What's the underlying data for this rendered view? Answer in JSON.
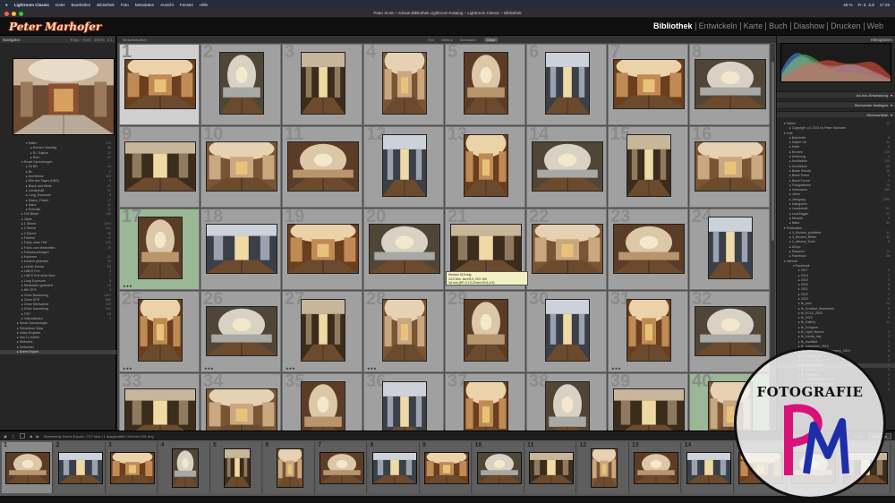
{
  "menubar": {
    "app": "Lightroom Classic",
    "items": [
      "Datei",
      "Bearbeiten",
      "Bibliothek",
      "Foto",
      "Metadaten",
      "Ansicht",
      "Fenster",
      "Hilfe"
    ],
    "status_items": [
      "48 %",
      "Fr. 5. Juli",
      "17:25"
    ]
  },
  "window": {
    "title": "Peter Scott – Artisan-Bibliothek Lightroom-Katalog – Lightroom Classic – Bibliothek"
  },
  "identity": {
    "logo_text": "Peter Marhofer",
    "modules": [
      {
        "label": "Bibliothek",
        "active": true
      },
      {
        "label": "Entwickeln",
        "active": false
      },
      {
        "label": "Karte",
        "active": false
      },
      {
        "label": "Buch",
        "active": false
      },
      {
        "label": "Diashow",
        "active": false
      },
      {
        "label": "Drucken",
        "active": false
      },
      {
        "label": "Web",
        "active": false
      }
    ]
  },
  "left_panel": {
    "navigator_label": "Navigator",
    "zoom_tabs": [
      "Einp.",
      "Ausf.",
      "100%",
      "1:1"
    ],
    "tree": [
      {
        "label": "▾ Italien",
        "count": "214",
        "indent": 3
      },
      {
        "label": "▸ Kirchen Venedig",
        "count": "38",
        "indent": 4
      },
      {
        "label": "▸ St. Sulpice",
        "count": "12",
        "indent": 4
      },
      {
        "label": "▸ Rom",
        "count": "87",
        "indent": 4
      },
      {
        "label": "▾ Smart Sammlungen",
        "count": "",
        "indent": 2
      },
      {
        "label": "▸ 28 NR",
        "count": "14",
        "indent": 3
      },
      {
        "label": "▸ NL",
        "count": "9",
        "indent": 3
      },
      {
        "label": "▸ Architektur",
        "count": "120",
        "indent": 3
      },
      {
        "label": "▸ Bild des Tages (DBS)",
        "count": "6",
        "indent": 3
      },
      {
        "label": "▸ Black and White",
        "count": "22",
        "indent": 3
      },
      {
        "label": "▸ Landschaft",
        "count": "51",
        "indent": 3
      },
      {
        "label": "▸ Long_Exposure",
        "count": "8",
        "indent": 3
      },
      {
        "label": "▸ Makro_Flower",
        "count": "17",
        "indent": 3
      },
      {
        "label": "▸ Natur",
        "count": "40",
        "indent": 3
      },
      {
        "label": "▸ Portraits",
        "count": "11",
        "indent": 3
      },
      {
        "label": "▸ 100 Bilder",
        "count": "100",
        "indent": 2
      },
      {
        "label": "▸ Jahre",
        "count": "",
        "indent": 2
      },
      {
        "label": "▸ 1 Sterne",
        "count": "1004",
        "indent": 2
      },
      {
        "label": "▸ 2 Sterne",
        "count": "211",
        "indent": 2
      },
      {
        "label": "▸ 3 Sterne",
        "count": "98",
        "indent": 2
      },
      {
        "label": "▸ Farbton",
        "count": "12",
        "indent": 2
      },
      {
        "label": "▸ Fotos ohne Titel",
        "count": "320",
        "indent": 2
      },
      {
        "label": "▸ Fotos vom Webseiten",
        "count": "75",
        "indent": 2
      },
      {
        "label": "▸ Fotosammlungen",
        "count": "",
        "indent": 2
      },
      {
        "label": "▸ Kopieren",
        "count": "41",
        "indent": 2
      },
      {
        "label": "▸ kürzlich geändert",
        "count": "18",
        "indent": 2
      },
      {
        "label": "▸ Letzter Monat",
        "count": "64",
        "indent": 2
      },
      {
        "label": "▸ LINKS Frei",
        "count": "3",
        "indent": 2
      },
      {
        "label": "▸ LINKS Frei ohne Bew.",
        "count": "7",
        "indent": 2
      },
      {
        "label": "▸ Long Exposure",
        "count": "8",
        "indent": 2
      },
      {
        "label": "▸ Metadaten geändert",
        "count": "19",
        "indent": 2
      },
      {
        "label": "▸ NIK EFX",
        "count": "5",
        "indent": 2
      },
      {
        "label": "▸ Ohne Bewertung",
        "count": "1422",
        "indent": 2
      },
      {
        "label": "▸ Ohne GPS",
        "count": "880",
        "indent": 2
      },
      {
        "label": "▸ Ohne Stichwörter",
        "count": "233",
        "indent": 2
      },
      {
        "label": "▸ Ohne Sammlung",
        "count": "510",
        "indent": 2
      },
      {
        "label": "▸ TIFF",
        "count": "26",
        "indent": 2
      },
      {
        "label": "▸ Videodateien",
        "count": "2",
        "indent": 2
      },
      {
        "label": "▸ Smart Sammlungen",
        "count": "",
        "indent": 1
      },
      {
        "label": "▸ Teilnehmer Wow",
        "count": "",
        "indent": 1
      },
      {
        "label": "▸ Video Projekte",
        "count": "",
        "indent": 1
      },
      {
        "label": "▸ Von Lr mobile",
        "count": "",
        "indent": 1
      },
      {
        "label": "▸ Websites",
        "count": "",
        "indent": 1
      },
      {
        "label": "▸ Zielordner",
        "count": "",
        "indent": 1
      },
      {
        "label": "▸ Dome Export",
        "count": "",
        "indent": 1,
        "selected": true
      }
    ],
    "import_button": "Importieren...",
    "export_button": "Exportieren..."
  },
  "filter_bar": {
    "label": "Bibliotheksfilter:",
    "items": [
      "Text",
      "Attribut",
      "Metadaten",
      "Ohne"
    ],
    "selected": "Ohne"
  },
  "grid": {
    "cells": [
      {
        "n": "1",
        "sel": true,
        "portrait": false,
        "stars": ""
      },
      {
        "n": "2",
        "portrait": true,
        "stars": ""
      },
      {
        "n": "3",
        "portrait": true,
        "stars": ""
      },
      {
        "n": "4",
        "portrait": true,
        "stars": ""
      },
      {
        "n": "5",
        "portrait": true,
        "stars": ""
      },
      {
        "n": "6",
        "portrait": true,
        "stars": ""
      },
      {
        "n": "7",
        "portrait": false,
        "stars": ""
      },
      {
        "n": "8",
        "portrait": false,
        "stars": ""
      },
      {
        "n": "9",
        "portrait": false,
        "stars": ""
      },
      {
        "n": "10",
        "portrait": false,
        "stars": ""
      },
      {
        "n": "11",
        "portrait": false,
        "stars": ""
      },
      {
        "n": "12",
        "portrait": true,
        "stars": ""
      },
      {
        "n": "13",
        "portrait": true,
        "stars": ""
      },
      {
        "n": "14",
        "portrait": false,
        "stars": ""
      },
      {
        "n": "15",
        "portrait": true,
        "stars": ""
      },
      {
        "n": "16",
        "portrait": false,
        "stars": ""
      },
      {
        "n": "17",
        "green": true,
        "portrait": true,
        "stars": "★★★"
      },
      {
        "n": "18",
        "portrait": false,
        "stars": ""
      },
      {
        "n": "19",
        "portrait": false,
        "stars": ""
      },
      {
        "n": "20",
        "portrait": false,
        "stars": ""
      },
      {
        "n": "21",
        "portrait": false,
        "stars": ""
      },
      {
        "n": "22",
        "portrait": false,
        "stars": ""
      },
      {
        "n": "23",
        "portrait": false,
        "stars": ""
      },
      {
        "n": "24",
        "portrait": true,
        "stars": ""
      },
      {
        "n": "25",
        "portrait": true,
        "stars": "★★★"
      },
      {
        "n": "26",
        "portrait": false,
        "stars": "★★★"
      },
      {
        "n": "27",
        "portrait": true,
        "stars": "★★★"
      },
      {
        "n": "28",
        "portrait": true,
        "stars": "★★★"
      },
      {
        "n": "29",
        "portrait": true,
        "stars": ""
      },
      {
        "n": "30",
        "portrait": true,
        "stars": ""
      },
      {
        "n": "31",
        "portrait": true,
        "stars": "★★★"
      },
      {
        "n": "32",
        "portrait": false,
        "stars": ""
      },
      {
        "n": "33",
        "portrait": false,
        "stars": ""
      },
      {
        "n": "34",
        "portrait": false,
        "stars": ""
      },
      {
        "n": "35",
        "portrait": true,
        "stars": ""
      },
      {
        "n": "36",
        "portrait": true,
        "stars": ""
      },
      {
        "n": "37",
        "portrait": true,
        "stars": ""
      },
      {
        "n": "38",
        "portrait": true,
        "stars": ""
      },
      {
        "n": "39",
        "portrait": false,
        "stars": ""
      },
      {
        "n": "40",
        "green": true,
        "portrait": true,
        "stars": ""
      }
    ],
    "tooltip_lines": [
      "Kirchen 019.dng",
      "1/13 Sek. bei f/8,0, ISO 100",
      "16 mm (EF-S 10-22mm f/3.5-4.5)"
    ]
  },
  "toolbar": {
    "sort_label": "Sortieren:",
    "sort_value": "Benutzerdefinierte Reihenfolge",
    "label_colors": [
      "#d24b3b",
      "#e5c43b",
      "#5ab552",
      "#4f7fd8",
      "#9b55c8"
    ]
  },
  "right_panel": {
    "histogram_label": "Histogramm",
    "sections": [
      {
        "label": "Ad-hoc-Entwicklung",
        "right": "▾"
      },
      {
        "label": "Stichwörter festlegen",
        "right": "▾"
      },
      {
        "label": "Stichwortliste",
        "right": "▾"
      }
    ],
    "keywords": [
      {
        "label": "▾ Hallen",
        "count": "12"
      },
      {
        "label": "▸ Copyright: (c) 2024 by Peter Marhofer",
        "count": ""
      },
      {
        "label": "▾ Orte",
        "count": ""
      },
      {
        "label": "▸ Bahnhöfe",
        "count": "8"
      },
      {
        "label": "▸ Städte Ort",
        "count": "44"
      },
      {
        "label": "▸ Hotel",
        "count": "6"
      },
      {
        "label": "▸ Kirchen",
        "count": "230"
      },
      {
        "label": "▸ Wohnung",
        "count": "3"
      },
      {
        "label": "▸ Architektur",
        "count": "120"
      },
      {
        "label": "▸ Architektur",
        "count": "96"
      },
      {
        "label": "▸ Blaue Stunde",
        "count": "15"
      },
      {
        "label": "▸ Black Tower",
        "count": "4"
      },
      {
        "label": "▸ Black Found",
        "count": "2"
      },
      {
        "label": "▸ Fotografieren",
        "count": "70"
      },
      {
        "label": "▸ Innenraum",
        "count": "250"
      },
      {
        "label": "▸ Jahre",
        "count": ""
      },
      {
        "label": "▸ Jahrgang",
        "count": "1290"
      },
      {
        "label": "▸ Kategorien",
        "count": ""
      },
      {
        "label": "▸ Landschaft",
        "count": "51"
      },
      {
        "label": "▸ LensTagger",
        "count": "11"
      },
      {
        "label": "▸ Mensch",
        "count": "9"
      },
      {
        "label": "▸ Natur",
        "count": "40"
      },
      {
        "label": "▾ Publication",
        "count": ""
      },
      {
        "label": "▸ 4_Kirchen_publiziert",
        "count": "11"
      },
      {
        "label": "▸ 4_Kirchen_Bilder",
        "count": "33"
      },
      {
        "label": "▸ 4_albums_Tools",
        "count": "8"
      },
      {
        "label": "▸ 500px",
        "count": ""
      },
      {
        "label": "▸ Dayseen",
        "count": "14"
      },
      {
        "label": "▸ Facebook",
        "count": "28"
      },
      {
        "label": "▾ Internet",
        "count": ""
      },
      {
        "label": "▾ Facebook",
        "count": ""
      },
      {
        "label": "▸ 2017",
        "count": "5"
      },
      {
        "label": "▸ 2018",
        "count": "7"
      },
      {
        "label": "▸ 2019",
        "count": "9"
      },
      {
        "label": "▸ 2020",
        "count": "6"
      },
      {
        "label": "▸ 2021",
        "count": "8"
      },
      {
        "label": "▸ 2022",
        "count": "3"
      },
      {
        "label": "▸ 2023",
        "count": "4"
      },
      {
        "label": "▸ fb_post",
        "count": "12"
      },
      {
        "label": "▸ fb_Creative_Moments0",
        "count": "6"
      },
      {
        "label": "▸ fb_ECLE_2023",
        "count": "4"
      },
      {
        "label": "▸ fb_2023",
        "count": "9"
      },
      {
        "label": "▸ fb_Gallery",
        "count": "11"
      },
      {
        "label": "▸ fb_Gruppen",
        "count": ""
      },
      {
        "label": "▸ fb_Light_Ramon",
        "count": "3"
      },
      {
        "label": "▸ fb_media_day",
        "count": "2"
      },
      {
        "label": "▸ fb_modified",
        "count": "1"
      },
      {
        "label": "▸ fb_Instagram_2019",
        "count": "4"
      },
      {
        "label": "▸ fb_Landscape_Photography_2019",
        "count": "5"
      },
      {
        "label": "▸ fb_Landschaft",
        "count": "6"
      },
      {
        "label": "▸ fb_LOST_2019",
        "count": "2"
      },
      {
        "label": "▸ fb_LTOC_2022",
        "count": "1",
        "selected": true
      },
      {
        "label": "▸ fb_Natura_2019",
        "count": "3"
      },
      {
        "label": "▸ fb_Raspberry",
        "count": "2"
      },
      {
        "label": "▸ fb_Stadtfotografie_2019",
        "count": "7"
      },
      {
        "label": "▸ fb_Street_Photography",
        "count": "5"
      },
      {
        "label": "▸ fb_Urban_BW",
        "count": "4"
      }
    ]
  },
  "filmstrip": {
    "info": "Sammlung: Dome Export   / 72 Fotos / 1 ausgewählt / Kirchen 001.dng",
    "filter_label": "Filter:",
    "filter_value": "Filter aus",
    "cells": [
      "1",
      "2",
      "3",
      "4",
      "5",
      "6",
      "7",
      "8",
      "9",
      "10",
      "11",
      "12",
      "13",
      "14",
      "15",
      "16",
      "17"
    ]
  },
  "watermark": {
    "text": "FOTOGRAFIE",
    "monogram": "PM",
    "colors": {
      "p": "#d9127a",
      "m": "#1d2fa8"
    }
  }
}
